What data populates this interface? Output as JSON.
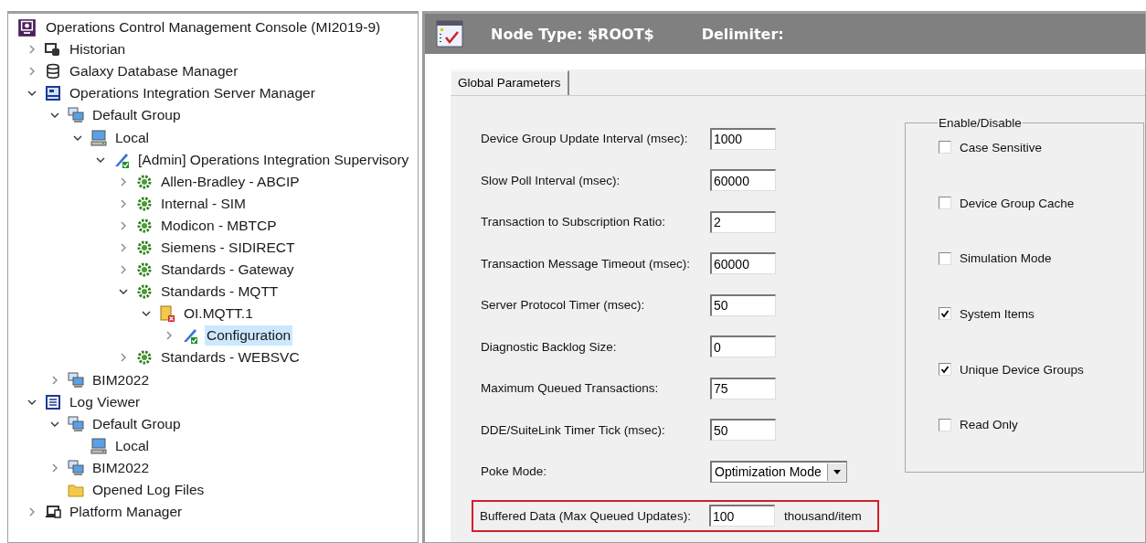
{
  "tree": [
    {
      "label": "Operations Control Management Console (MI2019-9)",
      "kind": "console",
      "selected": false,
      "children": [
        {
          "label": "Historian",
          "kind": "historian",
          "expanded": false,
          "selected": false
        },
        {
          "label": "Galaxy Database Manager",
          "kind": "database",
          "expanded": false,
          "selected": false
        },
        {
          "label": "Operations Integration Server Manager",
          "kind": "server-manager",
          "expanded": true,
          "selected": false,
          "children": [
            {
              "label": "Default Group",
              "kind": "group",
              "expanded": true,
              "selected": false,
              "children": [
                {
                  "label": "Local",
                  "kind": "computer",
                  "expanded": true,
                  "selected": false,
                  "children": [
                    {
                      "label": "[Admin] Operations Integration Supervisory",
                      "kind": "supervisory",
                      "expanded": true,
                      "selected": false,
                      "children": [
                        {
                          "label": "Allen-Bradley - ABCIP",
                          "kind": "gear",
                          "expanded": false,
                          "selected": false
                        },
                        {
                          "label": "Internal - SIM",
                          "kind": "gear",
                          "expanded": false,
                          "selected": false
                        },
                        {
                          "label": "Modicon - MBTCP",
                          "kind": "gear",
                          "expanded": false,
                          "selected": false
                        },
                        {
                          "label": "Siemens - SIDIRECT",
                          "kind": "gear",
                          "expanded": false,
                          "selected": false
                        },
                        {
                          "label": "Standards - Gateway",
                          "kind": "gear",
                          "expanded": false,
                          "selected": false
                        },
                        {
                          "label": "Standards - MQTT",
                          "kind": "gear",
                          "expanded": true,
                          "selected": false,
                          "children": [
                            {
                              "label": "OI.MQTT.1",
                              "kind": "object",
                              "expanded": true,
                              "selected": false,
                              "children": [
                                {
                                  "label": "Configuration",
                                  "kind": "supervisory",
                                  "expanded": false,
                                  "selected": true
                                }
                              ]
                            }
                          ]
                        },
                        {
                          "label": "Standards - WEBSVC",
                          "kind": "gear",
                          "expanded": false,
                          "selected": false
                        }
                      ]
                    }
                  ]
                }
              ]
            },
            {
              "label": "BIM2022",
              "kind": "group",
              "expanded": false,
              "selected": false
            }
          ]
        },
        {
          "label": "Log Viewer",
          "kind": "log-viewer",
          "expanded": true,
          "selected": false,
          "children": [
            {
              "label": "Default Group",
              "kind": "group",
              "expanded": true,
              "selected": false,
              "children": [
                {
                  "label": "Local",
                  "kind": "computer",
                  "selected": false
                }
              ]
            },
            {
              "label": "BIM2022",
              "kind": "group",
              "expanded": false,
              "selected": false
            },
            {
              "label": "Opened Log Files",
              "kind": "folder",
              "selected": false
            }
          ]
        },
        {
          "label": "Platform Manager",
          "kind": "platform",
          "expanded": false,
          "selected": false
        }
      ]
    }
  ],
  "header": {
    "node_type": "Node Type: $ROOT$",
    "delimiter": "Delimiter:"
  },
  "tabs": [
    {
      "label": "Global Parameters",
      "selected": true
    }
  ],
  "fields": [
    {
      "kind": "text",
      "label": "Device Group Update Interval (msec):",
      "value": "1000"
    },
    {
      "kind": "text",
      "label": "Slow Poll Interval (msec):",
      "value": "60000"
    },
    {
      "kind": "text",
      "label": "Transaction to Subscription Ratio:",
      "value": "2"
    },
    {
      "kind": "text",
      "label": "Transaction Message Timeout (msec):",
      "value": "60000"
    },
    {
      "kind": "text",
      "label": "Server Protocol Timer (msec):",
      "value": "50"
    },
    {
      "kind": "text",
      "label": "Diagnostic Backlog Size:",
      "value": "0"
    },
    {
      "kind": "text",
      "label": "Maximum Queued Transactions:",
      "value": "75"
    },
    {
      "kind": "text",
      "label": "DDE/SuiteLink Timer Tick (msec):",
      "value": "50"
    },
    {
      "kind": "select",
      "label": "Poke Mode:",
      "value": "Optimization Mode"
    },
    {
      "kind": "text",
      "label": "Buffered Data (Max Queued Updates):",
      "value": "100",
      "unit": "thousand/item",
      "highlighted": true
    }
  ],
  "options_group": {
    "title": "Enable/Disable",
    "options": [
      {
        "label": "Case Sensitive",
        "checked": false
      },
      {
        "label": "Device Group Cache",
        "checked": false
      },
      {
        "label": "Simulation Mode",
        "checked": false
      },
      {
        "label": "System Items",
        "checked": true
      },
      {
        "label": "Unique Device Groups",
        "checked": true
      },
      {
        "label": "Read Only",
        "checked": false
      }
    ]
  }
}
